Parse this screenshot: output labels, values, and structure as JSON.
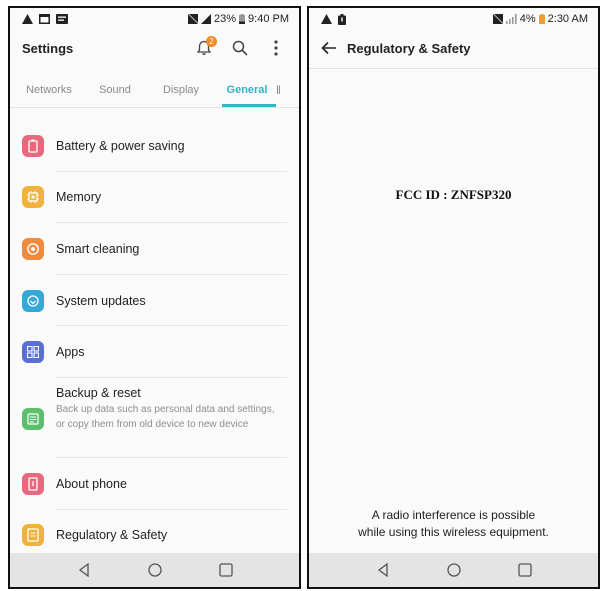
{
  "left": {
    "status": {
      "time": "9:40 PM",
      "battery": "23%"
    },
    "title": "Settings",
    "notification_badge": "2",
    "tabs": [
      {
        "label": "Networks"
      },
      {
        "label": "Sound"
      },
      {
        "label": "Display"
      },
      {
        "label": "General"
      }
    ],
    "items": [
      {
        "label": "Battery & power saving",
        "color": "#e8697d"
      },
      {
        "label": "Memory",
        "color": "#f0b23c"
      },
      {
        "label": "Smart cleaning",
        "color": "#ef8a3e"
      },
      {
        "label": "System updates",
        "color": "#34a9d8"
      },
      {
        "label": "Apps",
        "color": "#5a6fd6"
      },
      {
        "label": "Backup & reset",
        "sublabel": "Back up data such as personal data and settings, or copy them from old device to new device",
        "color": "#5cbf6e"
      },
      {
        "label": "About phone",
        "color": "#e8697d"
      },
      {
        "label": "Regulatory & Safety",
        "color": "#f0b23c"
      }
    ]
  },
  "right": {
    "status": {
      "time": "2:30 AM",
      "battery": "4%"
    },
    "title": "Regulatory & Safety",
    "fcc_id": "FCC ID : ZNFSP320",
    "notice_line1": "A radio interference is possible",
    "notice_line2": "while using this wireless equipment."
  }
}
